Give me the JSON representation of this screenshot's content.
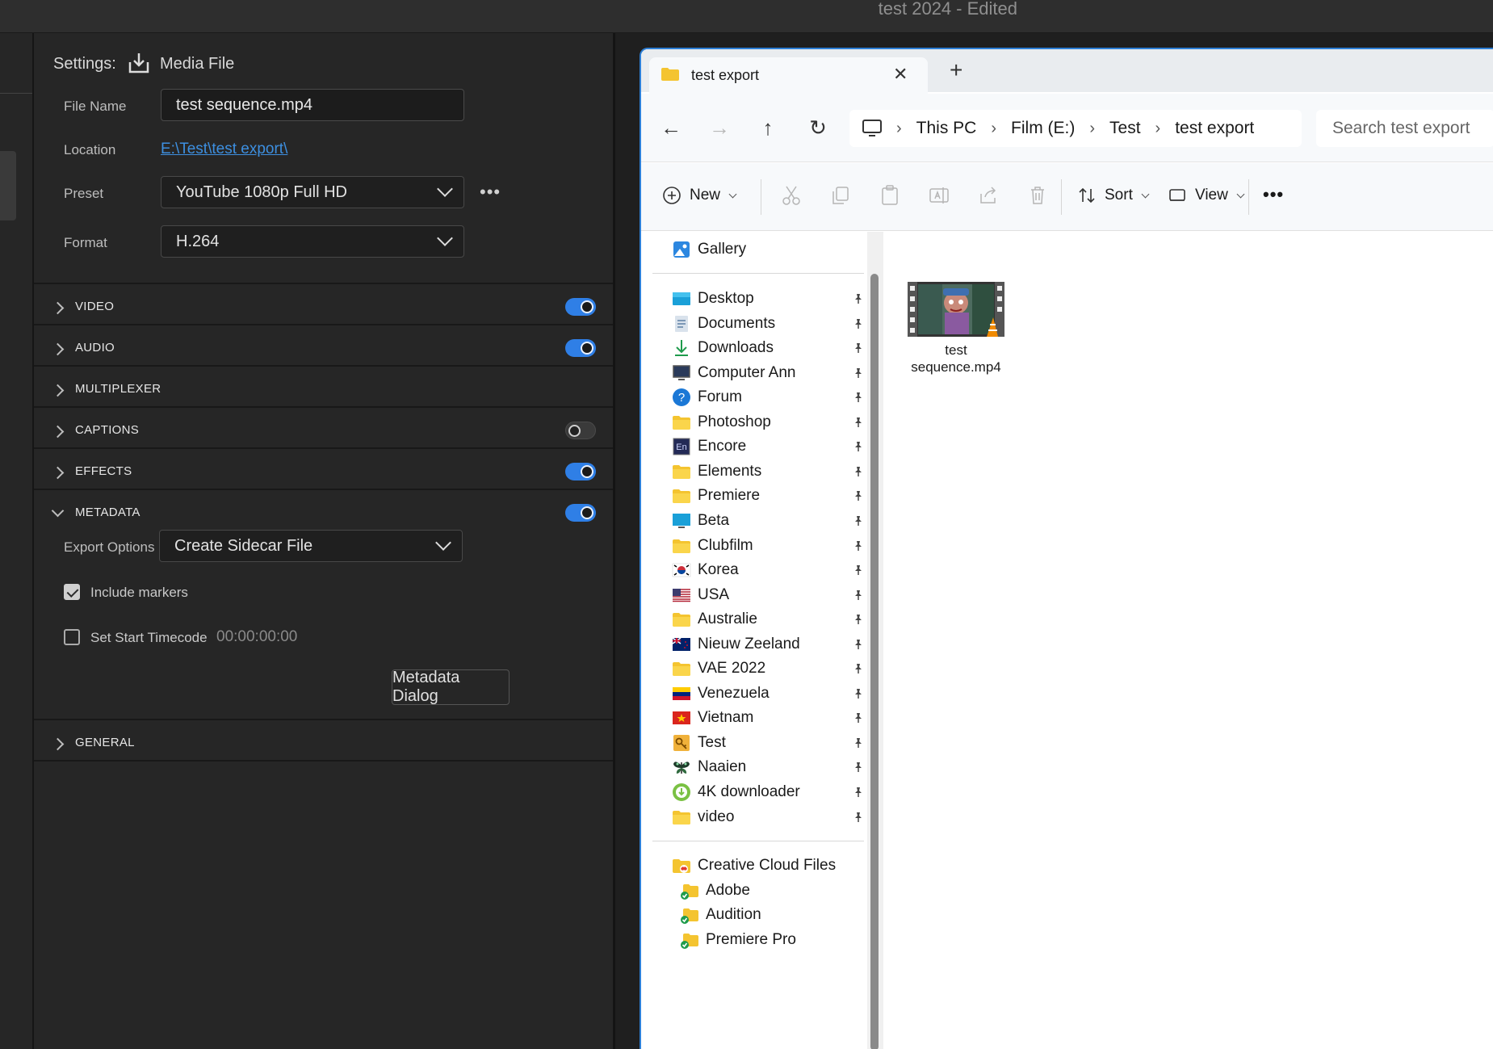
{
  "app": {
    "title": "test 2024",
    "edited": "- Edited"
  },
  "export": {
    "settings_label": "Settings:",
    "media_file_label": "Media File",
    "file_name_label": "File Name",
    "file_name_value": "test sequence.mp4",
    "location_label": "Location",
    "location_value": "E:\\Test\\test export\\",
    "preset_label": "Preset",
    "preset_value": "YouTube 1080p Full HD",
    "format_label": "Format",
    "format_value": "H.264",
    "more_label": "•••",
    "sections": [
      {
        "label": "VIDEO",
        "toggle": "on"
      },
      {
        "label": "AUDIO",
        "toggle": "on"
      },
      {
        "label": "MULTIPLEXER",
        "toggle": "none"
      },
      {
        "label": "CAPTIONS",
        "toggle": "off"
      },
      {
        "label": "EFFECTS",
        "toggle": "on"
      },
      {
        "label": "METADATA",
        "toggle": "on",
        "expanded": true
      },
      {
        "label": "GENERAL",
        "toggle": "none"
      }
    ],
    "metadata": {
      "export_options_label": "Export Options",
      "export_options_value": "Create Sidecar File",
      "include_markers_label": "Include markers",
      "include_markers_checked": true,
      "set_start_timecode_label": "Set Start Timecode",
      "set_start_timecode_checked": false,
      "timecode_value": "00:00:00:00",
      "metadata_dialog_label": "Metadata Dialog"
    },
    "accent_color": "#2f7fe6",
    "link_color": "#3d8fe0"
  },
  "explorer": {
    "tab_title": "test export",
    "tab_close": "✕",
    "new_tab": "+",
    "nav": {
      "back": "←",
      "forward": "→",
      "up": "↑",
      "refresh": "↻"
    },
    "breadcrumb": [
      "This PC",
      "Film (E:)",
      "Test",
      "test export"
    ],
    "breadcrumb_sep": "›",
    "search_placeholder": "Search test export",
    "commands": {
      "new": "New",
      "sort": "Sort",
      "view": "View",
      "more": "•••"
    },
    "sidebar_top": [
      {
        "label": "Gallery",
        "icon": "gallery-icon"
      }
    ],
    "quick_access": [
      {
        "label": "Desktop",
        "icon": "desktop-icon"
      },
      {
        "label": "Documents",
        "icon": "documents-icon"
      },
      {
        "label": "Downloads",
        "icon": "downloads-icon"
      },
      {
        "label": "Computer Ann",
        "icon": "computer-icon"
      },
      {
        "label": "Forum",
        "icon": "help-icon"
      },
      {
        "label": "Photoshop",
        "icon": "folder-icon"
      },
      {
        "label": "Encore",
        "icon": "encore-icon"
      },
      {
        "label": "Elements",
        "icon": "folder-icon"
      },
      {
        "label": "Premiere",
        "icon": "folder-icon"
      },
      {
        "label": "Beta",
        "icon": "monitor-icon"
      },
      {
        "label": "Clubfilm",
        "icon": "folder-icon"
      },
      {
        "label": "Korea",
        "icon": "korea-flag-icon"
      },
      {
        "label": "USA",
        "icon": "usa-flag-icon"
      },
      {
        "label": "Australie",
        "icon": "folder-icon"
      },
      {
        "label": "Nieuw Zeeland",
        "icon": "nz-flag-icon"
      },
      {
        "label": "VAE 2022",
        "icon": "folder-icon"
      },
      {
        "label": "Venezuela",
        "icon": "venezuela-flag-icon"
      },
      {
        "label": "Vietnam",
        "icon": "vietnam-flag-icon"
      },
      {
        "label": "Test",
        "icon": "key-icon"
      },
      {
        "label": "Naaien",
        "icon": "butterfly-icon"
      },
      {
        "label": "4K downloader",
        "icon": "4k-downloader-icon"
      },
      {
        "label": "video",
        "icon": "folder-icon"
      }
    ],
    "cloud": [
      {
        "label": "Creative Cloud Files",
        "icon": "creative-cloud-folder-icon",
        "indent": 0
      },
      {
        "label": "Adobe",
        "icon": "synced-folder-icon",
        "indent": 1
      },
      {
        "label": "Audition",
        "icon": "synced-folder-icon",
        "indent": 1
      },
      {
        "label": "Premiere Pro",
        "icon": "synced-folder-icon",
        "indent": 1
      }
    ],
    "files": [
      {
        "name": "test sequence.mp4",
        "icon": "vlc-video-thumbnail-icon"
      }
    ]
  }
}
